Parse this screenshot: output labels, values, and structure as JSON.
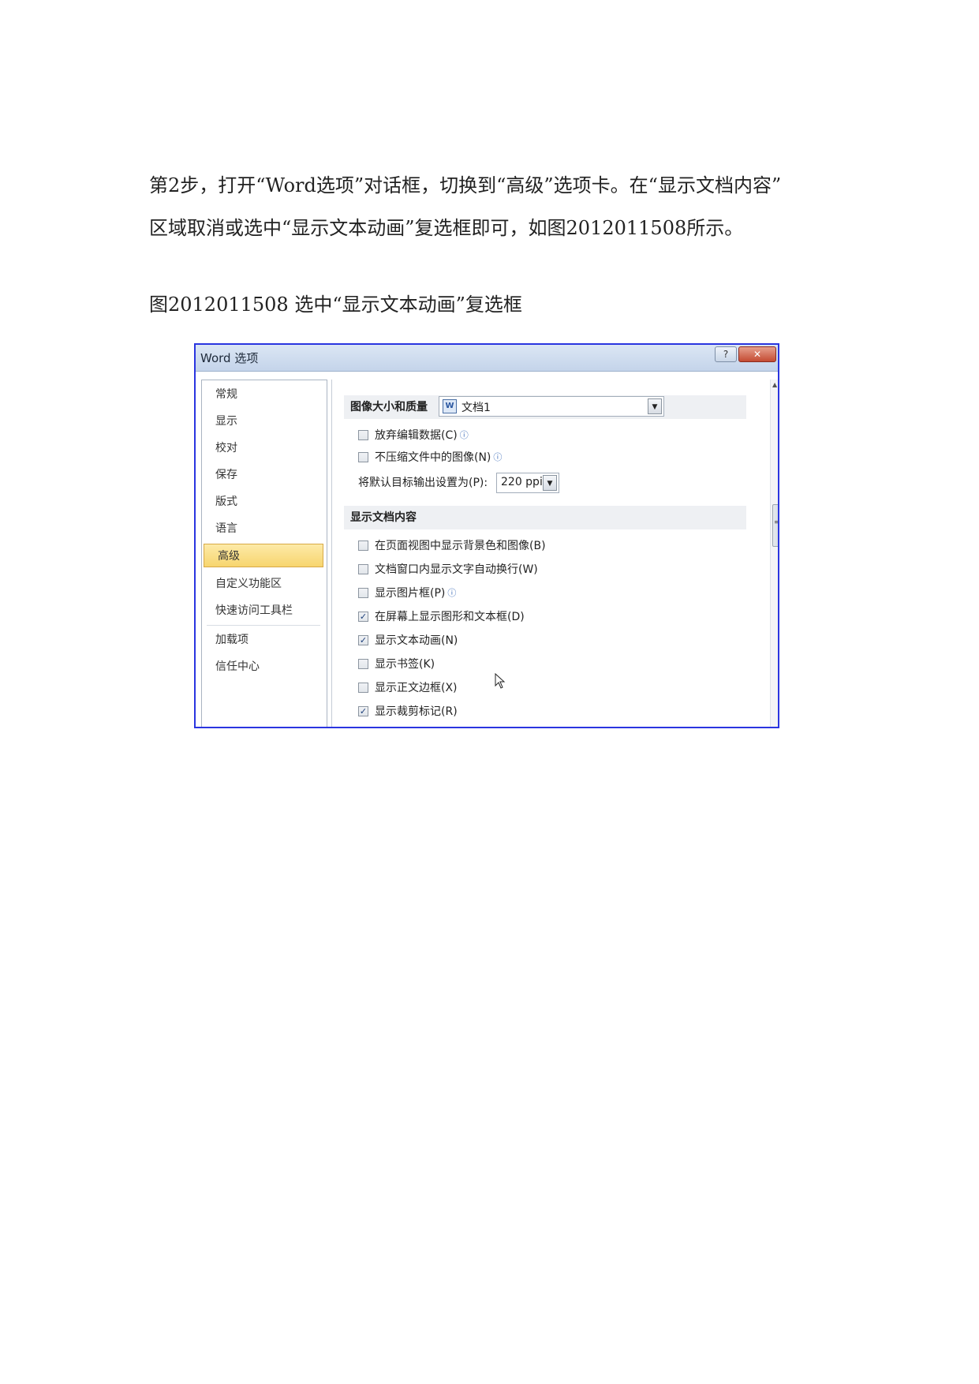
{
  "doc": {
    "para_line1": "第2步，打开“Word选项”对话框，切换到“高级”选项卡。在“显示文档内容”",
    "para_line2": "区域取消或选中“显示文本动画”复选框即可，如图2012011508所示。",
    "caption": "图2012011508 选中“显示文本动画”复选框"
  },
  "dialog": {
    "title": "Word 选项",
    "help_label": "?",
    "close_label": "✕",
    "nav": [
      {
        "label": "常规"
      },
      {
        "label": "显示"
      },
      {
        "label": "校对"
      },
      {
        "label": "保存"
      },
      {
        "label": "版式"
      },
      {
        "label": "语言"
      },
      {
        "label": "高级",
        "selected": true
      },
      {
        "label": "自定义功能区"
      },
      {
        "label": "快速访问工具栏"
      },
      {
        "label": "加载项"
      },
      {
        "label": "信任中心"
      }
    ],
    "image_section": {
      "heading": "图像大小和质量",
      "doc_select_value": "文档1",
      "options": [
        {
          "label": "放弃编辑数据(C)",
          "checked": false,
          "info": true
        },
        {
          "label": "不压缩文件中的图像(N)",
          "checked": false,
          "info": true
        }
      ],
      "ppi_label": "将默认目标输出设置为(P):",
      "ppi_value": "220 ppi"
    },
    "display_section": {
      "heading": "显示文档内容",
      "options": [
        {
          "label": "在页面视图中显示背景色和图像(B)",
          "checked": false
        },
        {
          "label": "文档窗口内显示文字自动换行(W)",
          "checked": false
        },
        {
          "label": "显示图片框(P)",
          "checked": false,
          "info": true
        },
        {
          "label": "在屏幕上显示图形和文本框(D)",
          "checked": true
        },
        {
          "label": "显示文本动画(N)",
          "checked": true
        },
        {
          "label": "显示书签(K)",
          "checked": false
        },
        {
          "label": "显示正文边框(X)",
          "checked": false
        },
        {
          "label": "显示裁剪标记(R)",
          "checked": true
        }
      ]
    }
  },
  "icons": {
    "doc": "word-document-icon",
    "info": "info-icon",
    "check": "✓",
    "dropdown": "▼",
    "scroll_up": "▲",
    "grip": "≡"
  }
}
